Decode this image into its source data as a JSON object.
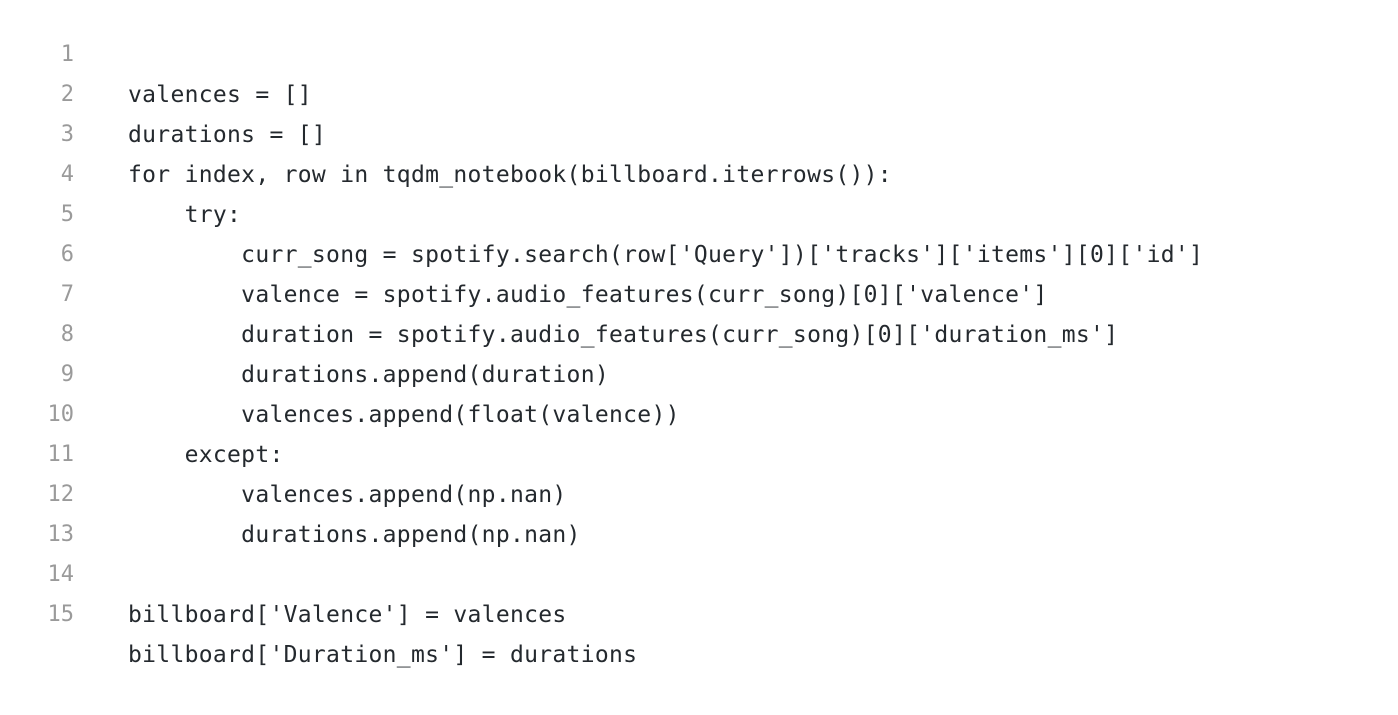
{
  "code_view": {
    "lines": [
      {
        "number": "1",
        "text": "valences = []"
      },
      {
        "number": "2",
        "text": "durations = []"
      },
      {
        "number": "3",
        "text": "for index, row in tqdm_notebook(billboard.iterrows()):"
      },
      {
        "number": "4",
        "text": "    try:"
      },
      {
        "number": "5",
        "text": "        curr_song = spotify.search(row['Query'])['tracks']['items'][0]['id']"
      },
      {
        "number": "6",
        "text": "        valence = spotify.audio_features(curr_song)[0]['valence']"
      },
      {
        "number": "7",
        "text": "        duration = spotify.audio_features(curr_song)[0]['duration_ms']"
      },
      {
        "number": "8",
        "text": "        durations.append(duration)"
      },
      {
        "number": "9",
        "text": "        valences.append(float(valence))"
      },
      {
        "number": "10",
        "text": "    except:"
      },
      {
        "number": "11",
        "text": "        valences.append(np.nan)"
      },
      {
        "number": "12",
        "text": "        durations.append(np.nan)"
      },
      {
        "number": "13",
        "text": ""
      },
      {
        "number": "14",
        "text": "billboard['Valence'] = valences"
      },
      {
        "number": "15",
        "text": "billboard['Duration_ms'] = durations"
      }
    ]
  }
}
